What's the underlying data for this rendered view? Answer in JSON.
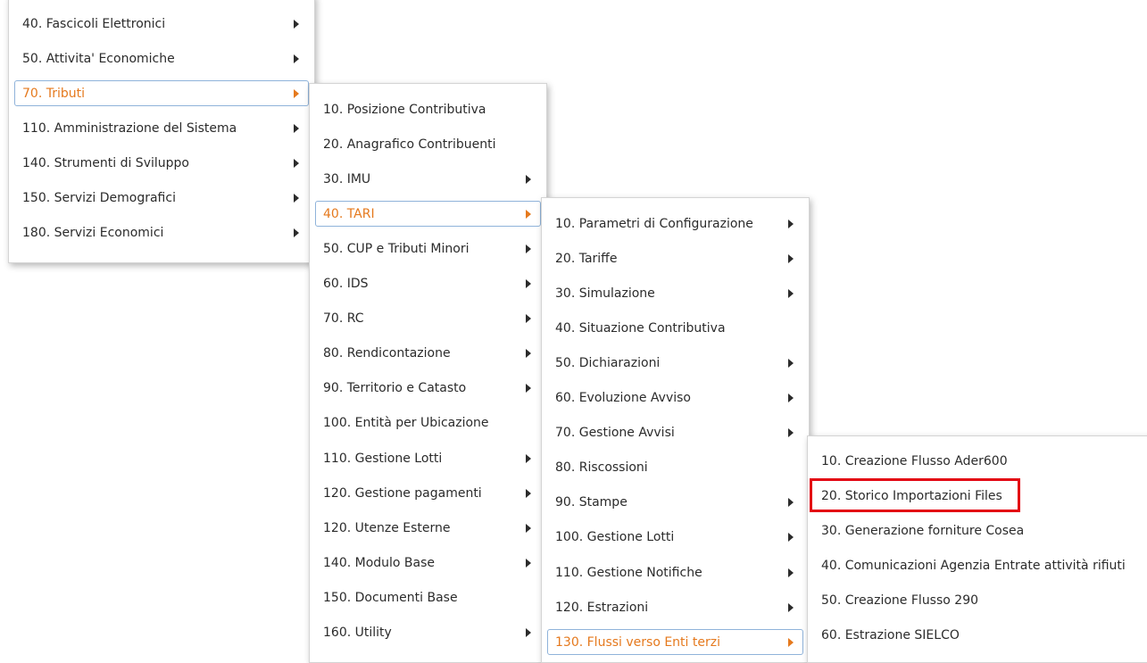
{
  "menu_level1": {
    "items": [
      {
        "label": "40. Fascicoli Elettronici",
        "has_submenu": true,
        "active": false
      },
      {
        "label": "50. Attivita' Economiche",
        "has_submenu": true,
        "active": false
      },
      {
        "label": "70. Tributi",
        "has_submenu": true,
        "active": true
      },
      {
        "label": "110. Amministrazione del Sistema",
        "has_submenu": true,
        "active": false
      },
      {
        "label": "140. Strumenti di Sviluppo",
        "has_submenu": true,
        "active": false
      },
      {
        "label": "150. Servizi Demografici",
        "has_submenu": true,
        "active": false
      },
      {
        "label": "180. Servizi Economici",
        "has_submenu": true,
        "active": false
      }
    ]
  },
  "menu_level2": {
    "items": [
      {
        "label": "10. Posizione Contributiva",
        "has_submenu": false,
        "active": false
      },
      {
        "label": "20. Anagrafico Contribuenti",
        "has_submenu": false,
        "active": false
      },
      {
        "label": "30. IMU",
        "has_submenu": true,
        "active": false
      },
      {
        "label": "40. TARI",
        "has_submenu": true,
        "active": true
      },
      {
        "label": "50. CUP e Tributi Minori",
        "has_submenu": true,
        "active": false
      },
      {
        "label": "60. IDS",
        "has_submenu": true,
        "active": false
      },
      {
        "label": "70. RC",
        "has_submenu": true,
        "active": false
      },
      {
        "label": "80. Rendicontazione",
        "has_submenu": true,
        "active": false
      },
      {
        "label": "90. Territorio e Catasto",
        "has_submenu": true,
        "active": false
      },
      {
        "label": "100. Entità per Ubicazione",
        "has_submenu": false,
        "active": false
      },
      {
        "label": "110. Gestione Lotti",
        "has_submenu": true,
        "active": false
      },
      {
        "label": "120. Gestione pagamenti",
        "has_submenu": true,
        "active": false
      },
      {
        "label": "120. Utenze Esterne",
        "has_submenu": true,
        "active": false
      },
      {
        "label": "140. Modulo Base",
        "has_submenu": true,
        "active": false
      },
      {
        "label": "150. Documenti Base",
        "has_submenu": false,
        "active": false
      },
      {
        "label": "160. Utility",
        "has_submenu": true,
        "active": false
      }
    ]
  },
  "menu_level3": {
    "items": [
      {
        "label": "10. Parametri di Configurazione",
        "has_submenu": true,
        "active": false
      },
      {
        "label": "20. Tariffe",
        "has_submenu": true,
        "active": false
      },
      {
        "label": "30. Simulazione",
        "has_submenu": true,
        "active": false
      },
      {
        "label": "40. Situazione Contributiva",
        "has_submenu": false,
        "active": false
      },
      {
        "label": "50. Dichiarazioni",
        "has_submenu": true,
        "active": false
      },
      {
        "label": "60. Evoluzione Avviso",
        "has_submenu": true,
        "active": false
      },
      {
        "label": "70. Gestione Avvisi",
        "has_submenu": true,
        "active": false
      },
      {
        "label": "80. Riscossioni",
        "has_submenu": false,
        "active": false
      },
      {
        "label": "90. Stampe",
        "has_submenu": true,
        "active": false
      },
      {
        "label": "100. Gestione Lotti",
        "has_submenu": true,
        "active": false
      },
      {
        "label": "110. Gestione Notifiche",
        "has_submenu": true,
        "active": false
      },
      {
        "label": "120. Estrazioni",
        "has_submenu": true,
        "active": false
      },
      {
        "label": "130. Flussi verso Enti terzi",
        "has_submenu": true,
        "active": true
      }
    ]
  },
  "menu_level4": {
    "items": [
      {
        "label": "10. Creazione Flusso Ader600",
        "has_submenu": false,
        "active": false
      },
      {
        "label": "20. Storico Importazioni Files",
        "has_submenu": false,
        "active": false,
        "highlighted": true
      },
      {
        "label": "30. Generazione forniture Cosea",
        "has_submenu": false,
        "active": false
      },
      {
        "label": "40. Comunicazioni Agenzia Entrate attività rifiuti",
        "has_submenu": false,
        "active": false
      },
      {
        "label": "50. Creazione Flusso 290",
        "has_submenu": false,
        "active": false
      },
      {
        "label": "60. Estrazione SIELCO",
        "has_submenu": false,
        "active": false
      }
    ]
  },
  "colors": {
    "active_text": "#e5791d",
    "active_border": "#8fb3da",
    "highlight_border": "#e30613"
  }
}
